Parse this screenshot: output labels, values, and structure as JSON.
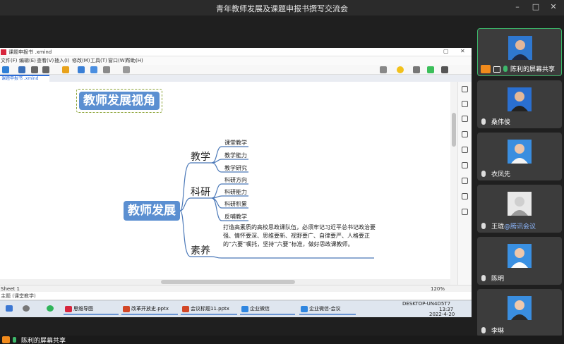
{
  "meeting": {
    "title": "青年教师发展及课题申报书撰写交流会",
    "min": "–",
    "max": "□",
    "close": "✕"
  },
  "xmind": {
    "file": "课题申报书 .xmind",
    "menu": [
      "文件(F)",
      "编辑(E)",
      "查看(V)",
      "插入(I)",
      "修改(M)",
      "工具(T)",
      "窗口(W)",
      "帮助(H)"
    ],
    "tab": "课题申报书 .xmind",
    "sheet": "Sheet 1",
    "zoom": "120%",
    "status2": "主题 (课堂教学)"
  },
  "mindmap": {
    "float_topic": "教师发展视角",
    "central": "教师发展",
    "branches": [
      {
        "label": "教学",
        "subs": [
          "课堂教学",
          "教学能力",
          "教学研究"
        ]
      },
      {
        "label": "科研",
        "subs": [
          "科研方向",
          "科研能力",
          "科研积累",
          "反哺教学"
        ]
      },
      {
        "label": "素养",
        "text": "打造高素质的高校思政课队伍，必须牢记习近平总书记政治要强、情怀要深、思维要新、视野要广、自律要严、人格要正的“六要”嘱托，坚持“六要”标准，做好思政课教师。"
      }
    ]
  },
  "taskbar": {
    "items": [
      "思维导图",
      "改革开放史.pptx",
      "会议标题11.pptx",
      "企业微信",
      "企业微信-会议"
    ],
    "tray_user": "DESKTOP-UN4D5T7",
    "time": "13:37",
    "date": "2022-4-20"
  },
  "participants": [
    {
      "name": "陈利的屏幕共享",
      "active": true
    },
    {
      "name": "桑伟俊"
    },
    {
      "name": "衣凤先"
    },
    {
      "name": "王珑",
      "tag": "@腾讯会议"
    },
    {
      "name": "陈明"
    },
    {
      "name": "李琳"
    }
  ],
  "bottom": {
    "label": "陈利的屏幕共享"
  }
}
